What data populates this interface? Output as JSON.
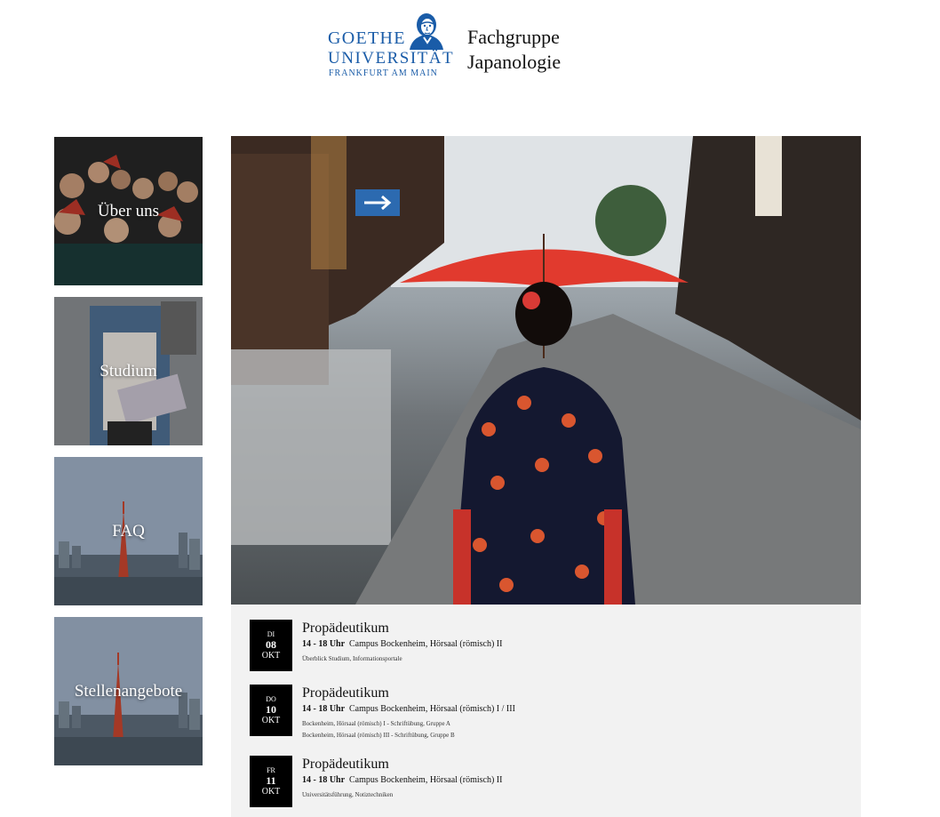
{
  "header": {
    "logo_line1": "GOETHE",
    "logo_line2": "UNIVERSITÄT",
    "logo_line3": "FRANKFURT AM MAIN",
    "dept_line1": "Fachgruppe",
    "dept_line2": "Japanologie",
    "brand_color": "#1a5ca8"
  },
  "tiles": [
    {
      "label": "Über uns"
    },
    {
      "label": "Studium"
    },
    {
      "label": "FAQ"
    },
    {
      "label": "Stellenangebote"
    }
  ],
  "events": [
    {
      "weekday": "DI",
      "day": "08",
      "month": "OKT",
      "title": "Propädeutikum",
      "time": "14 - 18 Uhr",
      "place": "Campus Bockenheim, Hörsaal (römisch) II",
      "details": [
        "Überblick Studium, Informationsportale"
      ]
    },
    {
      "weekday": "DO",
      "day": "10",
      "month": "OKT",
      "title": "Propädeutikum",
      "time": "14 - 18 Uhr",
      "place": "Campus Bockenheim, Hörsaal (römisch) I / III",
      "details": [
        "Bockenheim, Hörsaal (römisch) I - Schriftübung, Gruppe A",
        "Bockenheim, Hörsaal (römisch) III - Schriftübung, Gruppe B"
      ]
    },
    {
      "weekday": "FR",
      "day": "11",
      "month": "OKT",
      "title": "Propädeutikum",
      "time": "14 - 18 Uhr",
      "place": "Campus Bockenheim, Hörsaal (römisch) II",
      "details": [
        "Universitätsführung, Notiztechniken"
      ]
    }
  ]
}
